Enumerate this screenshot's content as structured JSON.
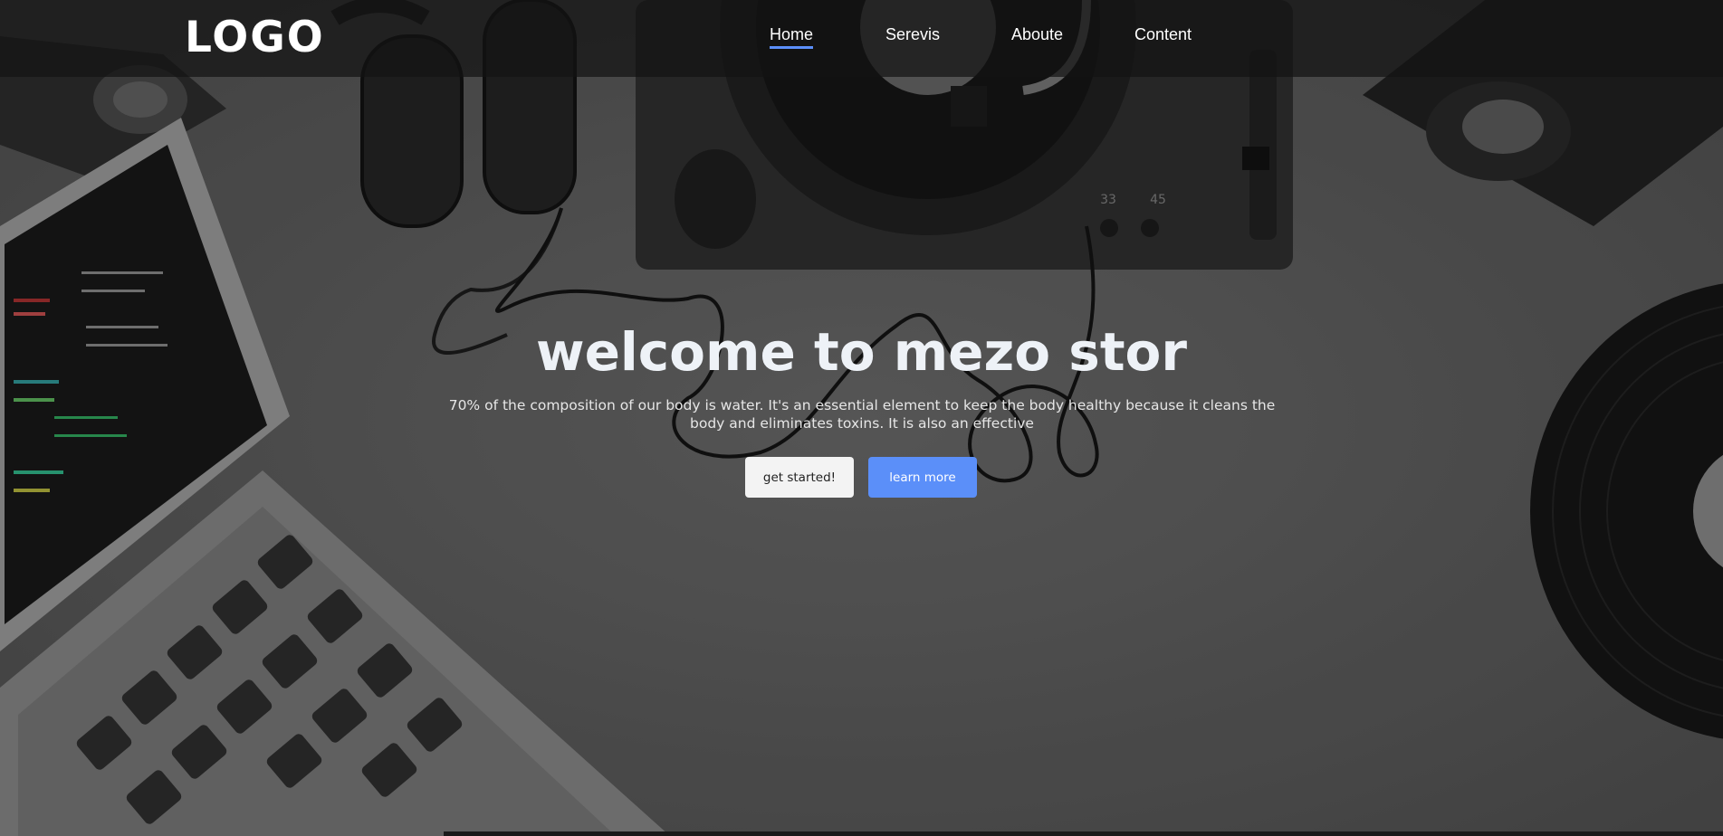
{
  "brand": {
    "logo_text": "LOGO"
  },
  "nav": {
    "items": [
      {
        "label": "Home",
        "active": true
      },
      {
        "label": "Serevis",
        "active": false
      },
      {
        "label": "Aboute",
        "active": false
      },
      {
        "label": "Content",
        "active": false
      }
    ],
    "active_underline_color": "#5b8ff9"
  },
  "hero": {
    "title": "welcome to mezo stor",
    "description": "70% of the composition of our body is water. It's an essential element to keep the body healthy because it cleans the body and eliminates toxins. It is also an effective",
    "buttons": {
      "primary_label": "get started!",
      "secondary_label": "learn more"
    },
    "turntable_speeds": [
      "33",
      "45"
    ],
    "background_description_icons": [
      "laptop-icon",
      "headphones-icon",
      "turntable-icon",
      "speaker-icon",
      "vinyl-record-icon"
    ]
  },
  "colors": {
    "accent": "#5b8ff9",
    "nav_background": "#141414",
    "hero_background": "#575757"
  }
}
